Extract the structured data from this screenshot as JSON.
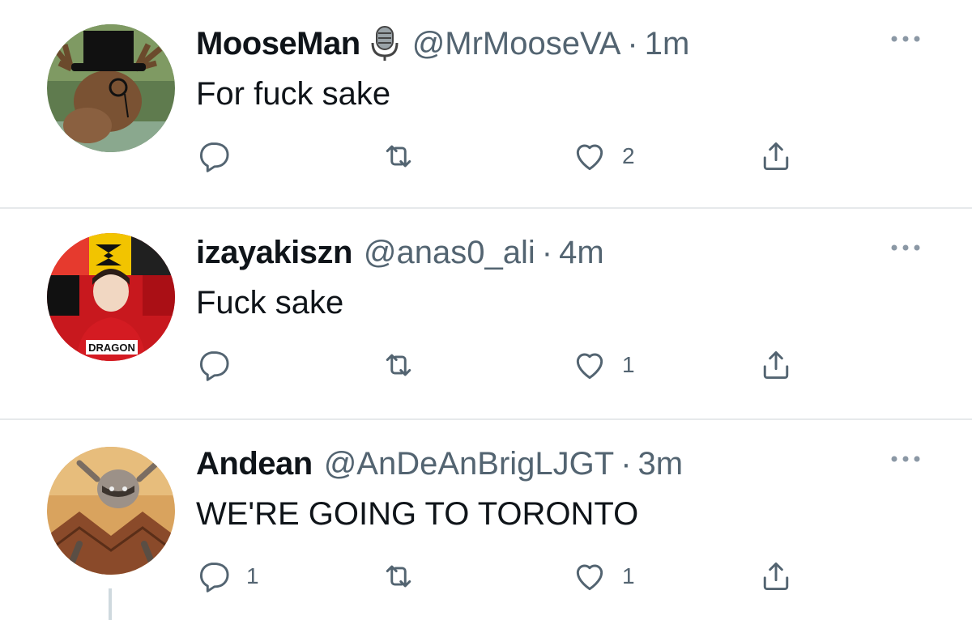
{
  "tweets": [
    {
      "name": "MooseMan",
      "handle": "@MrMooseVA",
      "separator": "·",
      "time": "1m",
      "text": "For fuck sake",
      "replies": "",
      "retweets": "",
      "likes": "2",
      "badge_icon": "microphone-icon",
      "avatar_icon": "moose-avatar"
    },
    {
      "name": "izayakiszn",
      "handle": "@anas0_ali",
      "separator": "·",
      "time": "4m",
      "text": "Fuck sake",
      "replies": "",
      "retweets": "",
      "likes": "1",
      "avatar_icon": "dragons-avatar",
      "avatar_text": "DRAGON"
    },
    {
      "name": "Andean",
      "handle": "@AnDeAnBrigLJGT",
      "separator": "·",
      "time": "3m",
      "text": "WE'RE GOING TO TORONTO",
      "replies": "1",
      "retweets": "",
      "likes": "1",
      "avatar_icon": "raccoon-avatar"
    }
  ],
  "colors": {
    "secondary_text": "#536471",
    "icon": "#536471",
    "divider": "#e6e9eb",
    "thread_line": "#cfd9de"
  }
}
